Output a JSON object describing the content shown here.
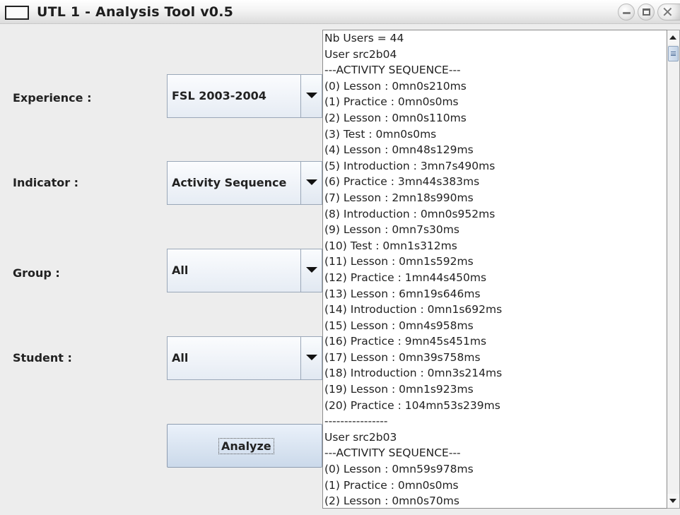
{
  "window": {
    "title": "UTL 1 - Analysis Tool v0.5"
  },
  "form": {
    "experience_label": "Experience :",
    "experience_value": "FSL 2003-2004",
    "indicator_label": "Indicator :",
    "indicator_value": "Activity Sequence",
    "group_label": "Group :",
    "group_value": "All",
    "student_label": "Student :",
    "student_value": "All",
    "analyze_label": "Analyze"
  },
  "output": {
    "lines": [
      "Nb Users = 44",
      "User src2b04",
      "---ACTIVITY SEQUENCE---",
      "(0) Lesson : 0mn0s210ms",
      "(1) Practice : 0mn0s0ms",
      "(2) Lesson : 0mn0s110ms",
      "(3) Test : 0mn0s0ms",
      "(4) Lesson : 0mn48s129ms",
      "(5) Introduction : 3mn7s490ms",
      "(6) Practice : 3mn44s383ms",
      "(7) Lesson : 2mn18s990ms",
      "(8) Introduction : 0mn0s952ms",
      "(9) Lesson : 0mn7s30ms",
      "(10) Test : 0mn1s312ms",
      "(11) Lesson : 0mn1s592ms",
      "(12) Practice : 1mn44s450ms",
      "(13) Lesson : 6mn19s646ms",
      "(14) Introduction : 0mn1s692ms",
      "(15) Lesson : 0mn4s958ms",
      "(16) Practice : 9mn45s451ms",
      "(17) Lesson : 0mn39s758ms",
      "(18) Introduction : 0mn3s214ms",
      "(19) Lesson : 0mn1s923ms",
      "(20) Practice : 104mn53s239ms",
      "----------------",
      "User src2b03",
      "---ACTIVITY SEQUENCE---",
      "(0) Lesson : 0mn59s978ms",
      "(1) Practice : 0mn0s0ms",
      "(2) Lesson : 0mn0s70ms"
    ]
  },
  "icons": {
    "window_icon": "window-icon",
    "minimize": "minimize-icon",
    "maximize": "maximize-icon",
    "close": "close-icon",
    "dropdown": "chevron-down-icon",
    "scroll_up": "arrow-up-icon",
    "scroll_down": "arrow-down-icon"
  },
  "colors": {
    "window_bg": "#ededed",
    "combo_border": "#9aa7b8",
    "button_gradient_bottom": "#cbd9ea",
    "text": "#222222"
  }
}
